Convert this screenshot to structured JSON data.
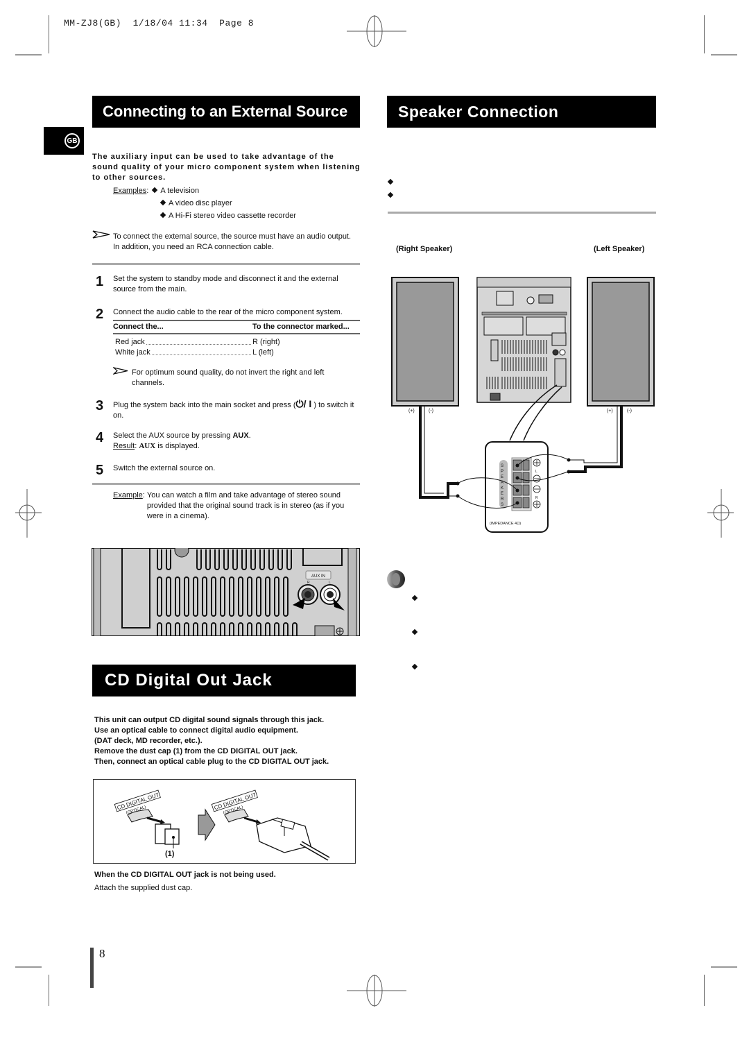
{
  "print_slug": {
    "model": "MM-ZJ8(GB)",
    "date": "1/18/04",
    "time": "11:34",
    "page_label": "Page",
    "page_number": "8"
  },
  "language_tab": {
    "label": "GB"
  },
  "external_source": {
    "title": "Connecting to an External Source",
    "intro": "The auxiliary input can be used to take advantage of the sound quality of your micro component system when listening to other sources.",
    "examples_label": "Examples",
    "examples": [
      "A television",
      "A video disc player",
      "A Hi-Fi stereo video cassette recorder"
    ],
    "note": "To connect the external source, the source must have an audio output. In addition, you need an RCA connection cable.",
    "steps": [
      {
        "number": "1",
        "text": "Set the system to standby mode and disconnect it and the external source from the main."
      },
      {
        "number": "2",
        "text": "Connect the audio cable to the rear of the micro component system."
      },
      {
        "number": "3",
        "text_before": "Plug the system back into the main socket and press (",
        "power_symbol": "⏻/ I",
        "text_after": ") to switch it on."
      },
      {
        "number": "4",
        "text_before": "Select the AUX source by pressing ",
        "bold": "AUX",
        "text_after": ".",
        "result_label": "Result",
        "result_bold": "AUX",
        "result_text": " is displayed."
      },
      {
        "number": "5",
        "text": "Switch the external source on."
      }
    ],
    "connect_table": {
      "headers": [
        "Connect the...",
        "To the connector marked..."
      ],
      "rows": [
        [
          "Red jack",
          "R (right)"
        ],
        [
          "White jack",
          "L (left)"
        ]
      ]
    },
    "channel_note": "For optimum sound quality, do not invert the right and left channels.",
    "example_label": "Example",
    "example_text": "You can watch a film and take advantage of stereo sound provided that the original sound track is in stereo (as if you were in a cinema).",
    "diagram": {
      "aux_label": "AUX IN",
      "r": "R",
      "l": "L"
    }
  },
  "cd_digital": {
    "title": "CD Digital Out Jack",
    "lines": [
      "This unit can output CD digital sound signals through this jack.",
      "Use an optical cable to connect digital audio equipment.",
      "(DAT deck, MD recorder, etc.).",
      "Remove the dust cap (1) from the CD DIGITAL OUT jack.",
      "Then, connect an optical cable plug to the CD DIGITAL OUT jack."
    ],
    "diagram": {
      "jack_label": "CD DIGITAL OUT",
      "jack_sub": "(OPTICAL)",
      "callout": "(1)"
    },
    "unused_heading": "When the CD DIGITAL OUT jack is not being used.",
    "unused_text": "Attach the supplied dust cap."
  },
  "speaker": {
    "title": "Speaker Connection",
    "right_label": "(Right Speaker)",
    "left_label": "(Left Speaker)",
    "plus": "(+)",
    "minus": "(-)",
    "terminal": {
      "letters": [
        "S",
        "P",
        "E",
        "A",
        "K",
        "E",
        "R",
        "S"
      ],
      "l": "L",
      "r": "R",
      "impedance": "(IMPEDANCE 4Ω)"
    }
  },
  "footer": {
    "page_number": "8"
  }
}
